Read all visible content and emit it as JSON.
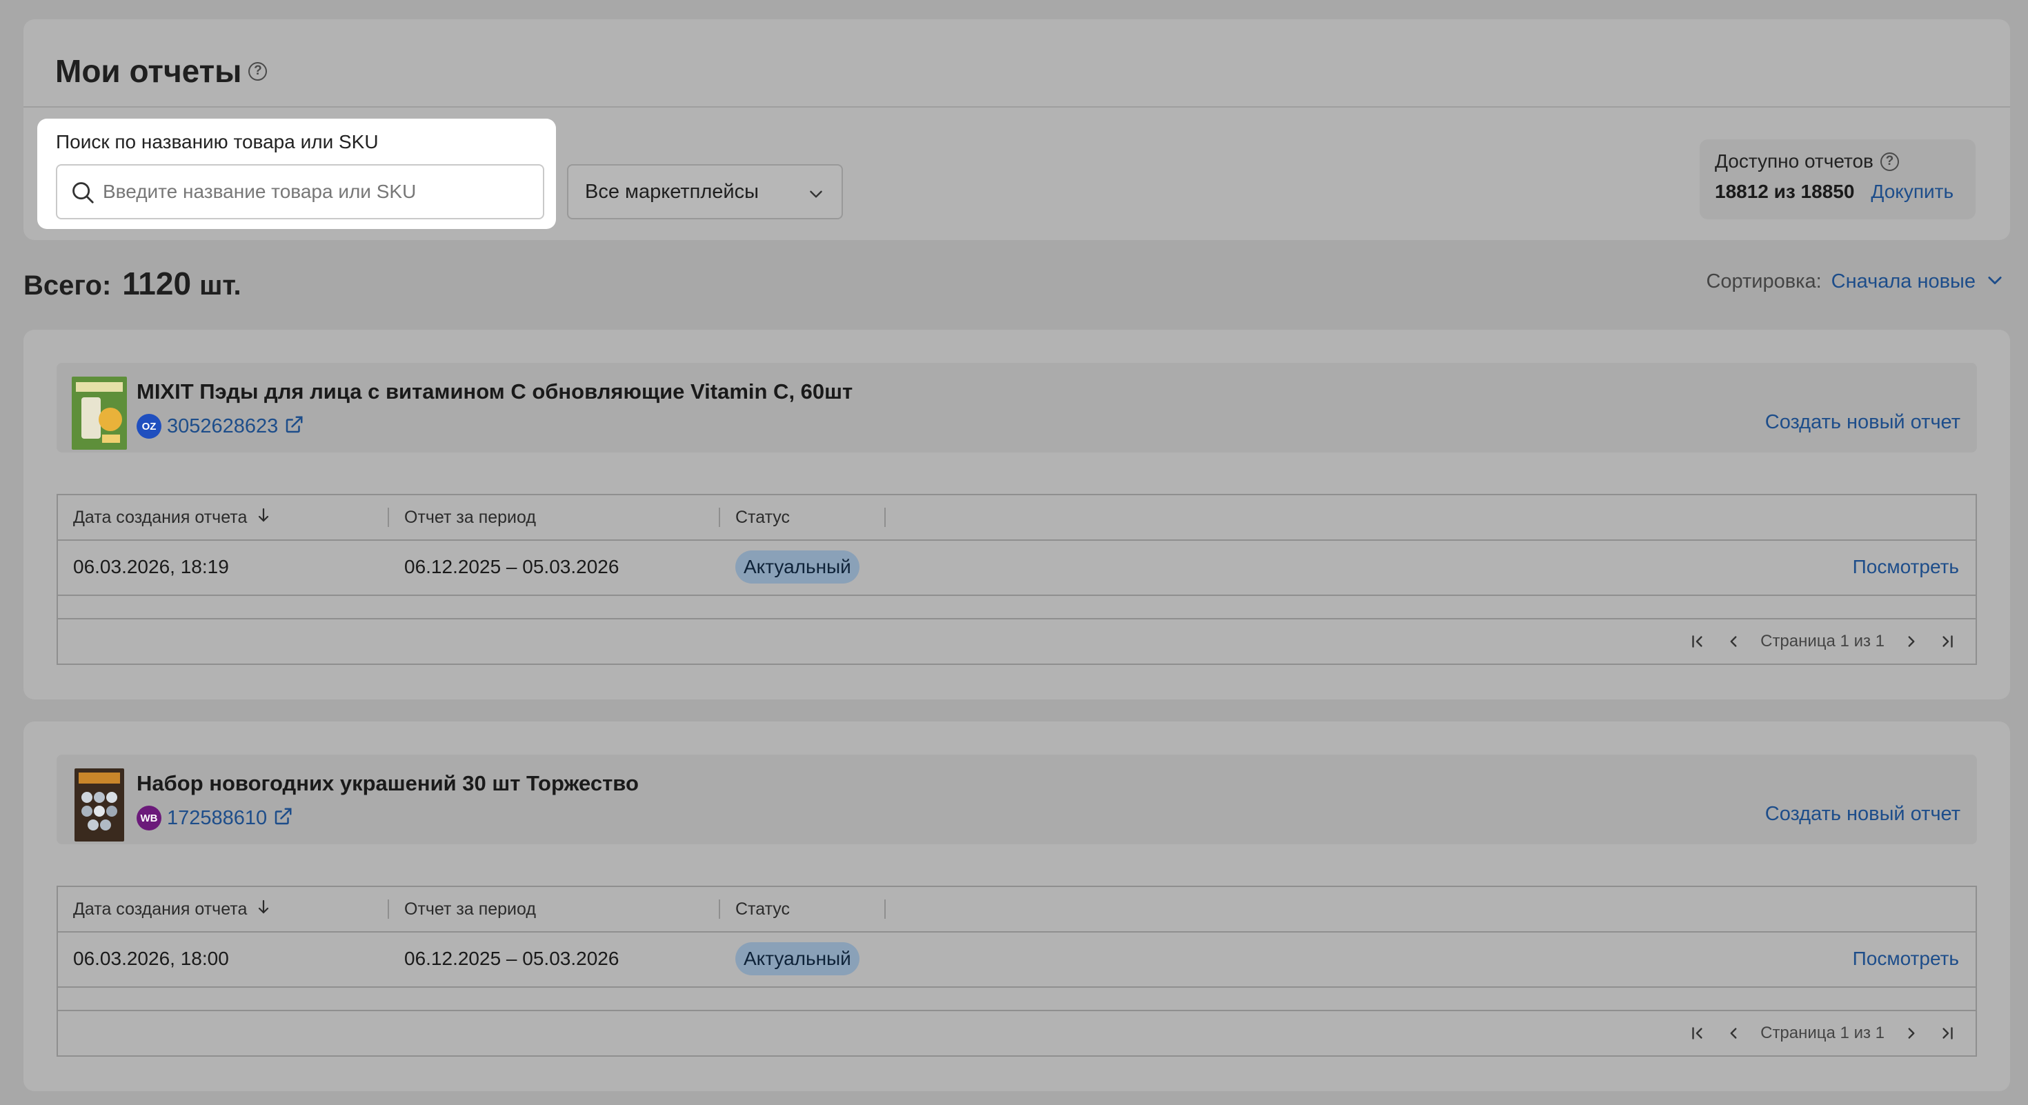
{
  "header": {
    "title": "Мои отчеты",
    "help_icon": "?"
  },
  "search": {
    "label": "Поиск по названию товара или SKU",
    "placeholder": "Введите название товара или SKU",
    "value": ""
  },
  "marketplace_filter": {
    "selected": "Все маркетплейсы"
  },
  "quota": {
    "label": "Доступно отчетов",
    "value": "18812 из 18850",
    "buy_link": "Докупить"
  },
  "summary": {
    "total_label": "Всего:",
    "total_count": "1120",
    "total_unit": "шт."
  },
  "sort": {
    "label": "Сортировка:",
    "value": "Сначала новые"
  },
  "table_headers": {
    "created": "Дата создания отчета",
    "period": "Отчет за период",
    "status": "Статус"
  },
  "products": [
    {
      "title": "MIXIT Пэды для лица с витамином С обновляющие Vitamin C, 60шт",
      "marketplace_badge": "OZ",
      "marketplace_color": "#1f4fbf",
      "sku": "3052628623",
      "create_report": "Создать новый отчет",
      "reports": [
        {
          "created": "06.03.2026, 18:19",
          "period": "06.12.2025 – 05.03.2026",
          "status": "Актуальный",
          "action": "Посмотреть"
        }
      ],
      "pagination": "Страница 1 из 1"
    },
    {
      "title": "Набор новогодних украшений 30 шт Торжество",
      "marketplace_badge": "WB",
      "marketplace_color": "#6b1a7a",
      "sku": "172588610",
      "create_report": "Создать новый отчет",
      "reports": [
        {
          "created": "06.03.2026, 18:00",
          "period": "06.12.2025 – 05.03.2026",
          "status": "Актуальный",
          "action": "Посмотреть"
        }
      ],
      "pagination": "Страница 1 из 1"
    }
  ]
}
